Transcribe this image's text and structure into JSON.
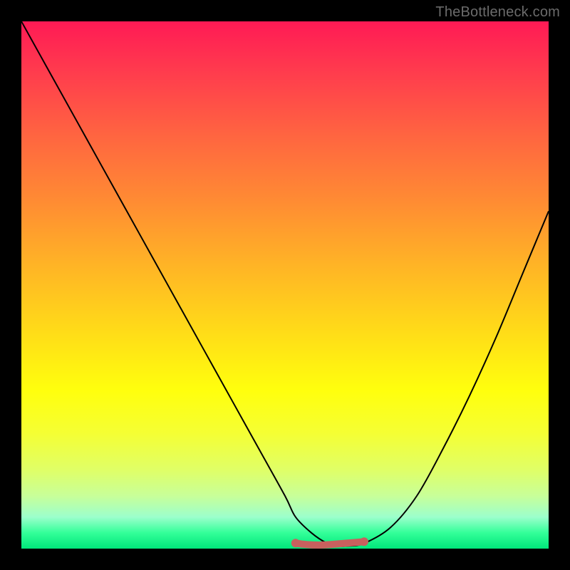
{
  "watermark": "TheBottleneck.com",
  "colors": {
    "frame": "#000000",
    "curve": "#000000",
    "flat_marker": "#c8605e",
    "gradient_top": "#ff1a55",
    "gradient_bottom": "#00e67a"
  },
  "chart_data": {
    "type": "line",
    "title": "",
    "xlabel": "",
    "ylabel": "",
    "xlim": [
      0,
      100
    ],
    "ylim": [
      0,
      100
    ],
    "grid": false,
    "legend": false,
    "series": [
      {
        "name": "bottleneck-curve",
        "x": [
          0,
          5,
          10,
          15,
          20,
          25,
          30,
          35,
          40,
          45,
          50,
          52,
          55,
          58,
          60,
          62,
          65,
          70,
          75,
          80,
          85,
          90,
          95,
          100
        ],
        "y": [
          100,
          91,
          82,
          73,
          64,
          55,
          46,
          37,
          28,
          19,
          10,
          6,
          3,
          1,
          0.5,
          0.5,
          1,
          4,
          10,
          19,
          29,
          40,
          52,
          64
        ]
      }
    ],
    "annotations": [
      {
        "name": "optimal-flat-region",
        "x_start": 52,
        "x_end": 65,
        "y": 0.5,
        "color": "#c8605e"
      }
    ],
    "background": {
      "type": "vertical-gradient",
      "stops": [
        {
          "pos": 0.0,
          "color": "#ff1a55"
        },
        {
          "pos": 0.5,
          "color": "#ffd919"
        },
        {
          "pos": 0.75,
          "color": "#ffff0d"
        },
        {
          "pos": 1.0,
          "color": "#00e67a"
        }
      ],
      "meaning": "red-high-bottleneck-to-green-low-bottleneck"
    }
  }
}
